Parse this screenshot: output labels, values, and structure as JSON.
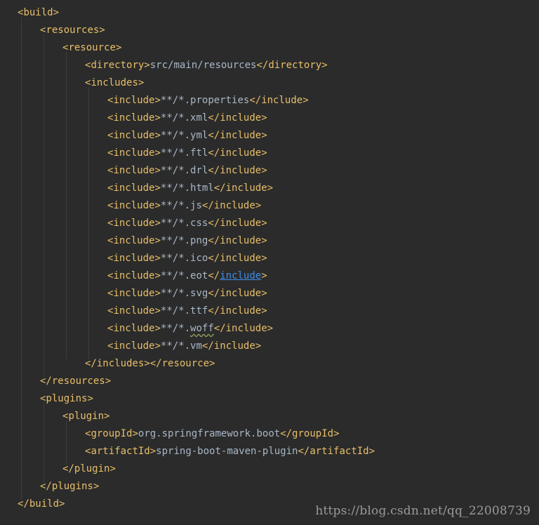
{
  "code_lines": [
    {
      "indent": 0,
      "open_tag": "build",
      "text": "",
      "close_tag": ""
    },
    {
      "indent": 1,
      "open_tag": "resources",
      "text": "",
      "close_tag": ""
    },
    {
      "indent": 2,
      "open_tag": "resource",
      "text": "",
      "close_tag": ""
    },
    {
      "indent": 3,
      "open_tag": "directory",
      "text": "src/main/resources",
      "close_tag": "directory"
    },
    {
      "indent": 3,
      "open_tag": "includes",
      "text": "",
      "close_tag": ""
    },
    {
      "indent": 4,
      "open_tag": "include",
      "text": "**/*.properties",
      "close_tag": "include"
    },
    {
      "indent": 4,
      "open_tag": "include",
      "text": "**/*.xml",
      "close_tag": "include"
    },
    {
      "indent": 4,
      "open_tag": "include",
      "text": "**/*.yml",
      "close_tag": "include"
    },
    {
      "indent": 4,
      "open_tag": "include",
      "text": "**/*.ftl",
      "close_tag": "include"
    },
    {
      "indent": 4,
      "open_tag": "include",
      "text": "**/*.drl",
      "close_tag": "include"
    },
    {
      "indent": 4,
      "open_tag": "include",
      "text": "**/*.html",
      "close_tag": "include"
    },
    {
      "indent": 4,
      "open_tag": "include",
      "text": "**/*.js",
      "close_tag": "include"
    },
    {
      "indent": 4,
      "open_tag": "include",
      "text": "**/*.css",
      "close_tag": "include"
    },
    {
      "indent": 4,
      "open_tag": "include",
      "text": "**/*.png",
      "close_tag": "include"
    },
    {
      "indent": 4,
      "open_tag": "include",
      "text": "**/*.ico",
      "close_tag": "include"
    },
    {
      "indent": 4,
      "open_tag": "include",
      "text": "**/*.eot",
      "close_tag": "include",
      "close_is_link": true
    },
    {
      "indent": 4,
      "open_tag": "include",
      "text": "**/*.svg",
      "close_tag": "include"
    },
    {
      "indent": 4,
      "open_tag": "include",
      "text": "**/*.ttf",
      "close_tag": "include"
    },
    {
      "indent": 4,
      "open_tag": "include",
      "text": "**/*.woff",
      "close_tag": "include",
      "text_squiggle": "woff"
    },
    {
      "indent": 4,
      "open_tag": "include",
      "text": "**/*.vm",
      "close_tag": "include"
    },
    {
      "indent": 3,
      "close_only": [
        "includes",
        "resource"
      ]
    },
    {
      "indent": 1,
      "close_only": [
        "resources"
      ]
    },
    {
      "indent": 1,
      "open_tag": "plugins",
      "text": "",
      "close_tag": ""
    },
    {
      "indent": 2,
      "open_tag": "plugin",
      "text": "",
      "close_tag": ""
    },
    {
      "indent": 3,
      "open_tag": "groupId",
      "text": "org.springframework.boot",
      "close_tag": "groupId"
    },
    {
      "indent": 3,
      "open_tag": "artifactId",
      "text": "spring-boot-maven-plugin",
      "close_tag": "artifactId"
    },
    {
      "indent": 2,
      "close_only": [
        "plugin"
      ]
    },
    {
      "indent": 1,
      "close_only": [
        "plugins"
      ]
    },
    {
      "indent": 0,
      "close_only": [
        "build"
      ]
    }
  ],
  "watermark": "https://blog.csdn.net/qq_22008739",
  "colors": {
    "background": "#2b2b2b",
    "tag": "#e8bf6a",
    "text": "#a9b7c6",
    "link": "#3d8eea"
  }
}
